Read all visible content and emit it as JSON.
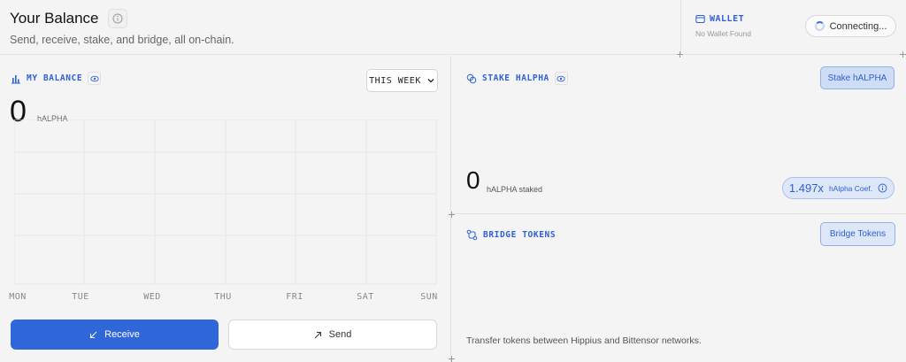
{
  "header": {
    "title": "Your Balance",
    "subtitle": "Send, receive, stake, and bridge, all on-chain."
  },
  "wallet": {
    "label": "WALLET",
    "status": "No Wallet Found",
    "connect_label": "Connecting..."
  },
  "balance": {
    "section_label": "MY BALANCE",
    "period_label": "THIS WEEK",
    "amount": "0",
    "unit": "hALPHA",
    "days": [
      "MON",
      "TUE",
      "WED",
      "THU",
      "FRI",
      "SAT",
      "SUN"
    ],
    "receive_label": "Receive",
    "send_label": "Send"
  },
  "stake": {
    "section_label": "STAKE HALPHA",
    "button_label": "Stake hALPHA",
    "amount": "0",
    "unit": "hALPHA staked",
    "coefficient": "1.497x",
    "coefficient_label": "hAlpha Coef."
  },
  "bridge": {
    "section_label": "BRIDGE TOKENS",
    "button_label": "Bridge Tokens",
    "description": "Transfer tokens between Hippius and Bittensor networks."
  },
  "colors": {
    "accent": "#2f66d9",
    "accent_light": "#dde7f8",
    "background": "#f4f4f4"
  }
}
